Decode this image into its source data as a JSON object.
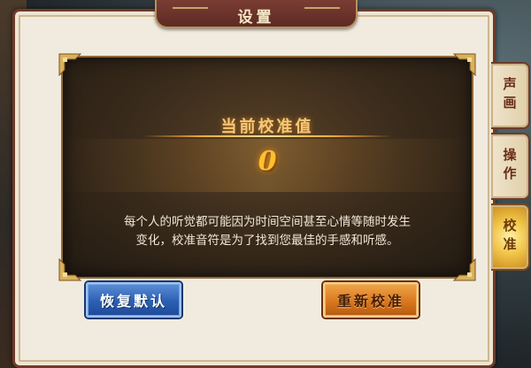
{
  "window": {
    "title": "设置"
  },
  "calibration": {
    "label": "当前校准值",
    "value": "0",
    "description_line1": "每个人的听觉都可能因为时间空间甚至心情等随时发生",
    "description_line2": "变化，校准音符是为了找到您最佳的手感和听感。"
  },
  "buttons": {
    "reset": "恢复默认",
    "recalibrate": "重新校准"
  },
  "tabs": [
    {
      "label": "声画",
      "active": false
    },
    {
      "label": "操作",
      "active": false
    },
    {
      "label": "校准",
      "active": true
    }
  ],
  "colors": {
    "panel": "#f1ebdf",
    "frame": "#6d3b2a",
    "accent_gold": "#ffbf30",
    "blue_button": "#2c5fb4",
    "orange_button": "#d9781e"
  }
}
